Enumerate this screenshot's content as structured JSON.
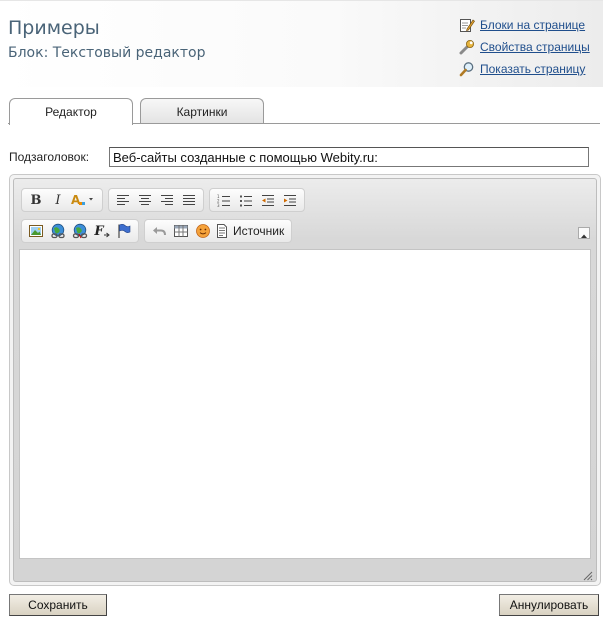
{
  "header": {
    "title": "Примеры",
    "subtitle": "Блок: Текстовый редактор",
    "links": [
      {
        "label": "Блоки на странице",
        "icon": "pencil-note-icon"
      },
      {
        "label": "Свойства страницы",
        "icon": "wrench-icon"
      },
      {
        "label": "Показать страницу",
        "icon": "magnifier-icon"
      }
    ]
  },
  "tabs": [
    {
      "label": "Редактор",
      "active": true
    },
    {
      "label": "Картинки",
      "active": false
    }
  ],
  "form": {
    "subtitle_label": "Подзаголовок:",
    "subtitle_value": "Веб-сайты созданные с помощью Webity.ru:"
  },
  "editor": {
    "source_label": "Источник",
    "bold_label": "B",
    "italic_label": "I",
    "format_label": "F"
  },
  "actions": {
    "save_label": "Сохранить",
    "cancel_label": "Аннулировать"
  },
  "colors": {
    "title": "#4a6478",
    "link": "#1f4e8c"
  }
}
